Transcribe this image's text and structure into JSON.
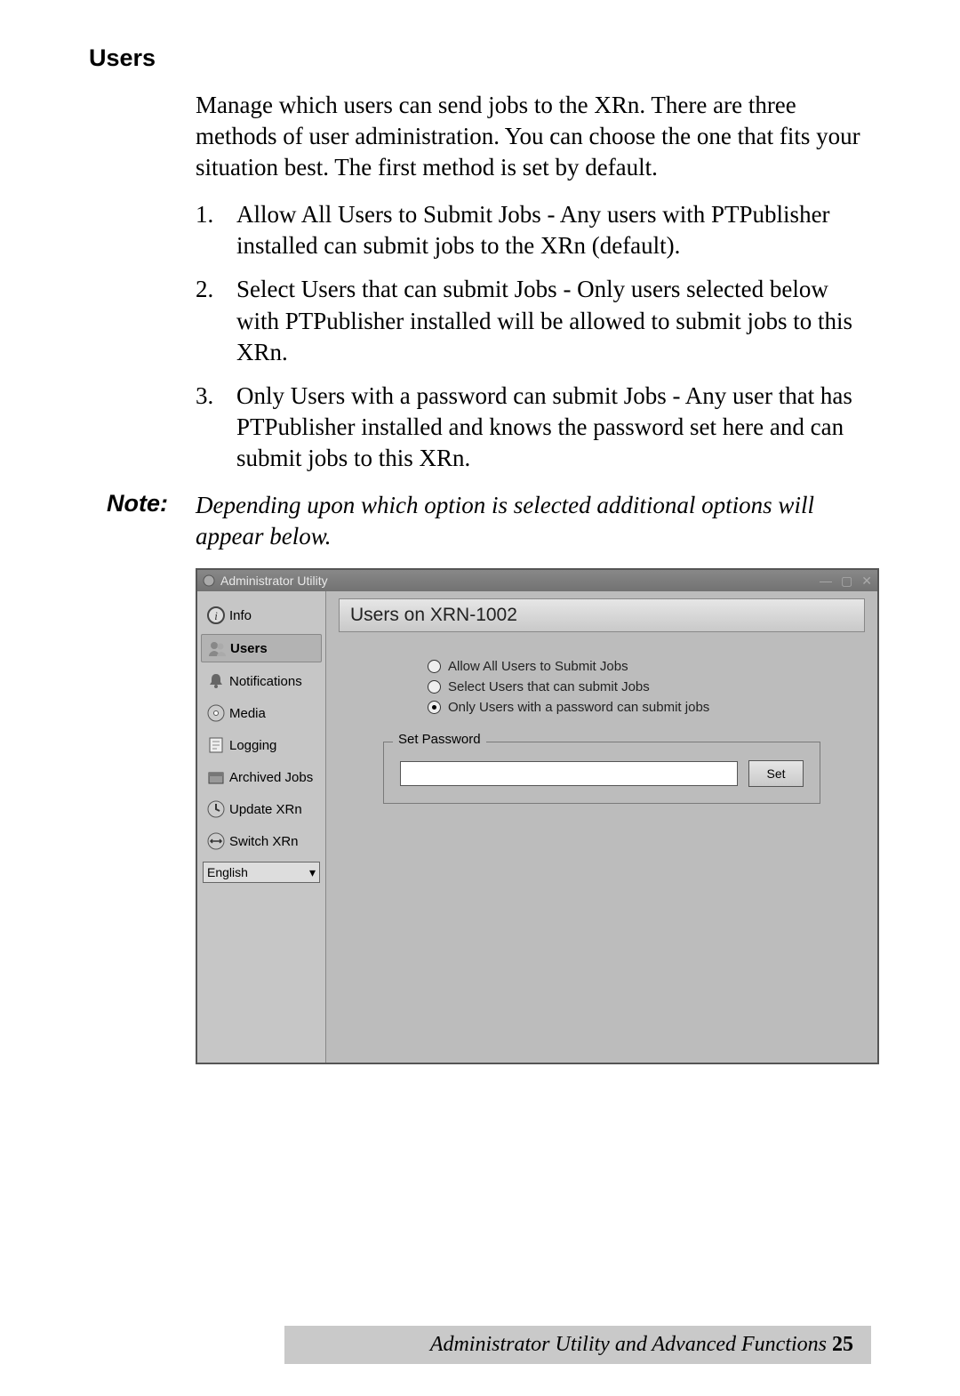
{
  "section_heading": "Users",
  "intro_para": "Manage which users can send jobs to the XRn.  There are three methods of user administration.  You can choose the one that fits your situation best.  The first method is set by default.",
  "list_items": [
    "Allow All Users to Submit Jobs - Any users with PTPublisher installed can submit jobs to the XRn (default).",
    "Select Users that can submit Jobs - Only users selected below with PTPublisher installed will be allowed to submit jobs to this XRn.",
    "Only Users with a password can submit Jobs - Any user that has PTPublisher installed and knows the password set here and can submit jobs to this XRn."
  ],
  "note_label": "Note:",
  "note_text": "Depending upon which option is selected additional options will appear below.",
  "window": {
    "title": "Administrator Utility",
    "sidebar": {
      "items": [
        {
          "label": "Info"
        },
        {
          "label": "Users"
        },
        {
          "label": "Notifications"
        },
        {
          "label": "Media"
        },
        {
          "label": "Logging"
        },
        {
          "label": "Archived Jobs"
        },
        {
          "label": "Update XRn"
        },
        {
          "label": "Switch XRn"
        }
      ],
      "language": "English"
    },
    "content": {
      "header": "Users on XRN-1002",
      "radios": [
        {
          "label": "Allow All Users to Submit Jobs",
          "selected": false
        },
        {
          "label": "Select Users that can submit Jobs",
          "selected": false
        },
        {
          "label": "Only Users with a password can submit jobs",
          "selected": true
        }
      ],
      "fieldset_legend": "Set Password",
      "set_button": "Set"
    }
  },
  "footer": {
    "text": "Administrator Utility and Advanced Functions",
    "page": "25"
  }
}
